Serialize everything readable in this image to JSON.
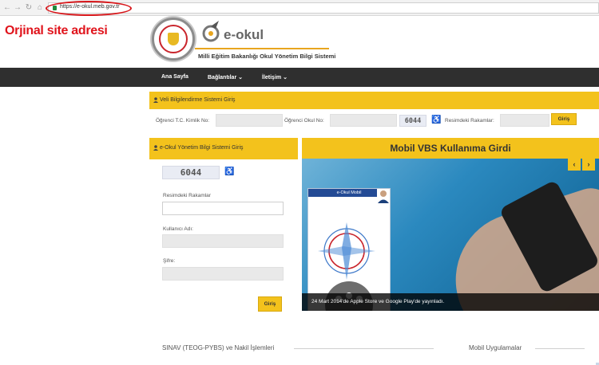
{
  "browser": {
    "url": "https://e-okul.meb.gov.tr",
    "nav_icons": [
      "back-icon",
      "forward-icon",
      "reload-icon",
      "home-icon"
    ]
  },
  "header": {
    "annotation": "Orjinal site adresi",
    "logo_text": "e-okul",
    "ministry_text": "Milli Eğitim Bakanlığı Okul Yönetim Bilgi Sistemi"
  },
  "navbar": {
    "items": [
      {
        "label": "Ana Sayfa"
      },
      {
        "label": "Bağlantılar ⌄"
      },
      {
        "label": "İletişim ⌄"
      }
    ]
  },
  "parent_login": {
    "title": "Veli Bilgilendirme Sistemi Giriş",
    "tc_label": "Öğrenci T.C. Kimlik No:",
    "school_no_label": "Öğrenci Okul No:",
    "captcha": "6044",
    "captcha_label": "Resimdeki Rakamlar:",
    "submit": "Giriş"
  },
  "staff_login": {
    "title": "e-Okul Yönetim Bilgi Sistemi Giriş",
    "captcha": "6044",
    "captcha_label": "Resimdeki Rakamlar",
    "username_label": "Kullanıcı Adı:",
    "password_label": "Şifre:",
    "submit": "Giriş"
  },
  "slider": {
    "title": "Mobil VBS Kullanıma Girdi",
    "phone_header": "e-Okul Mobil",
    "caption": "24 Mart 2014'de Apple Store ve Google Play'de yayınladı.",
    "prev": "‹",
    "next": "›"
  },
  "footer": {
    "left_title": "SINAV (TEOG-PYBS) ve Nakil İşlemleri",
    "right_title": "Mobil Uygulamalar"
  },
  "colors": {
    "accent": "#f3c21c",
    "navbar": "#2f2f2f",
    "annotation": "#e0141c"
  }
}
